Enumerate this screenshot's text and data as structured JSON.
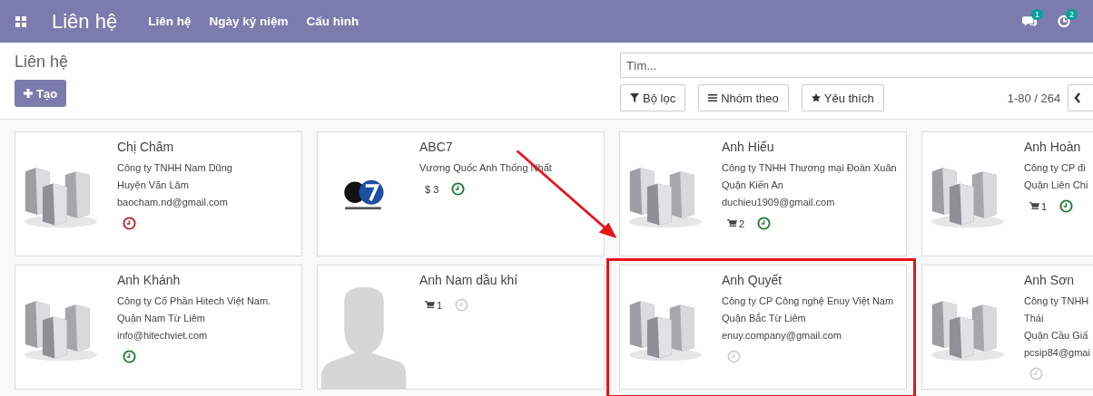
{
  "navbar": {
    "app_title": "Liên hệ",
    "menu": [
      "Liên hệ",
      "Ngày kỷ niệm",
      "Cấu hình"
    ],
    "messages_count": "1",
    "activities_count": "2"
  },
  "control_panel": {
    "breadcrumb": "Liên hệ",
    "create_button": "Tạo",
    "search": {
      "placeholder": "Tìm..."
    },
    "filters": [
      {
        "kind": "filter",
        "label": "Bộ lọc"
      },
      {
        "kind": "group",
        "label": "Nhóm theo"
      },
      {
        "kind": "favorite",
        "label": "Yêu thích"
      }
    ],
    "pager": "1-80 / 264"
  },
  "cards": [
    {
      "kind": "building",
      "name": "Chị Châm",
      "lines": [
        "Công ty TNHH Nam Dũng",
        "Huyện Văn Lâm",
        "baocham.nd@gmail.com"
      ],
      "activity": {
        "color": "#b8242c"
      },
      "highlighted": false
    },
    {
      "kind": "logo",
      "name": "ABC7",
      "lines": [
        "Vương Quốc Anh Thống Nhất"
      ],
      "badges": [
        {
          "kind": "money",
          "text": "$ 3"
        }
      ],
      "activity": {
        "color": "#1e7a34"
      },
      "highlighted": false
    },
    {
      "kind": "building",
      "name": "Anh Hiếu",
      "lines": [
        "Công ty TNHH Thương mại Đoàn Xuân",
        "Quận Kiến An",
        "duchieu1909@gmail.com"
      ],
      "badges": [
        {
          "kind": "cart",
          "text": "2"
        }
      ],
      "activity": {
        "color": "#1e7a34"
      },
      "highlighted": false
    },
    {
      "kind": "building",
      "name": "Anh Hoàn",
      "lines": [
        "Công ty CP đi",
        "Quận Liên Chi"
      ],
      "badges": [
        {
          "kind": "cart",
          "text": "1"
        }
      ],
      "activity": {
        "color": "#1e7a34"
      },
      "highlighted": false
    },
    {
      "kind": "building",
      "name": "Anh Khánh",
      "lines": [
        "Công ty Cổ Phần Hitech Việt Nam.",
        "Quận Nam Từ Liêm",
        "info@hitechviet.com"
      ],
      "activity": {
        "color": "#1e7a34"
      },
      "highlighted": false
    },
    {
      "kind": "person",
      "name": "Anh Nam dầu khí",
      "badges": [
        {
          "kind": "cart",
          "text": "1"
        }
      ],
      "activity": {
        "color": "#d0d0d0"
      },
      "highlighted": false
    },
    {
      "kind": "building",
      "name": "Anh Quyết",
      "lines": [
        "Công ty CP Công nghệ Enuy Việt Nam",
        "Quận Bắc Từ Liêm",
        "enuy.company@gmail.com"
      ],
      "activity": {
        "color": "#d0d0d0"
      },
      "highlighted": true
    },
    {
      "kind": "building",
      "name": "Anh Sơn",
      "lines": [
        "Công ty TNHH",
        "Thái",
        "Quận Cầu Giấ",
        "pcsip84@gmai"
      ],
      "activity": {
        "color": "#d0d0d0"
      },
      "highlighted": false
    }
  ]
}
